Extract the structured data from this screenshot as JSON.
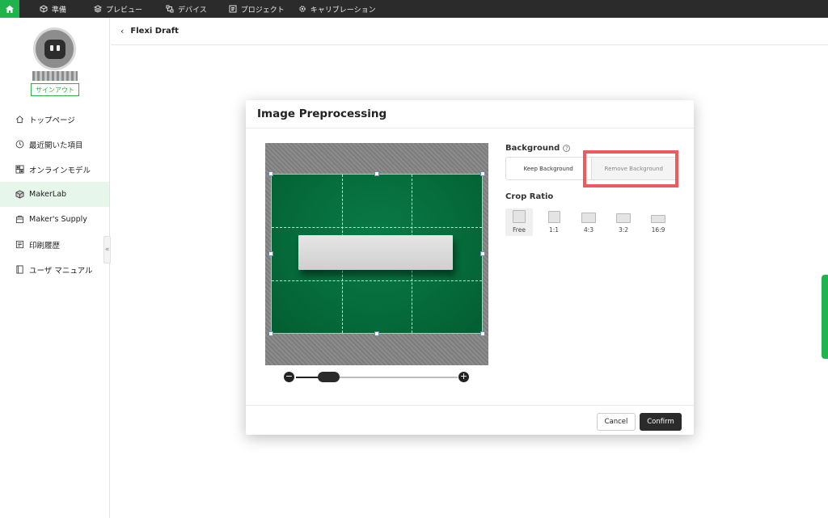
{
  "topnav": {
    "items": [
      {
        "label": "準備",
        "icon": "cube-icon"
      },
      {
        "label": "プレビュー",
        "icon": "layers-icon"
      },
      {
        "label": "デバイス",
        "icon": "device-icon"
      },
      {
        "label": "プロジェクト",
        "icon": "project-icon"
      },
      {
        "label": "キャリブレーション",
        "icon": "gear-icon"
      }
    ]
  },
  "sidebar": {
    "signout": "サインアウト",
    "items": [
      {
        "label": "トップページ",
        "icon": "home-icon"
      },
      {
        "label": "最近開いた項目",
        "icon": "clock-icon"
      },
      {
        "label": "オンラインモデル",
        "icon": "model-icon"
      },
      {
        "label": "MakerLab",
        "icon": "cube-icon",
        "active": true
      },
      {
        "label": "Maker's Supply",
        "icon": "box-icon"
      },
      {
        "label": "印刷履歴",
        "icon": "history-icon"
      },
      {
        "label": "ユーザ マニュアル",
        "icon": "book-icon"
      }
    ]
  },
  "main": {
    "title": "Flexi Draft"
  },
  "modal": {
    "title": "Image Preprocessing",
    "background_label": "Background",
    "keep_background": "Keep Background",
    "remove_background": "Remove Background",
    "crop_ratio_label": "Crop Ratio",
    "ratios": [
      {
        "label": "Free",
        "active": true
      },
      {
        "label": "1:1"
      },
      {
        "label": "4:3"
      },
      {
        "label": "3:2"
      },
      {
        "label": "16:9"
      }
    ],
    "zoom_level": 0.2,
    "cancel": "Cancel",
    "confirm": "Confirm"
  },
  "colors": {
    "accent_green": "#1fb34d",
    "highlight_red": "#f05a5f",
    "dark": "#2b2b2b"
  }
}
